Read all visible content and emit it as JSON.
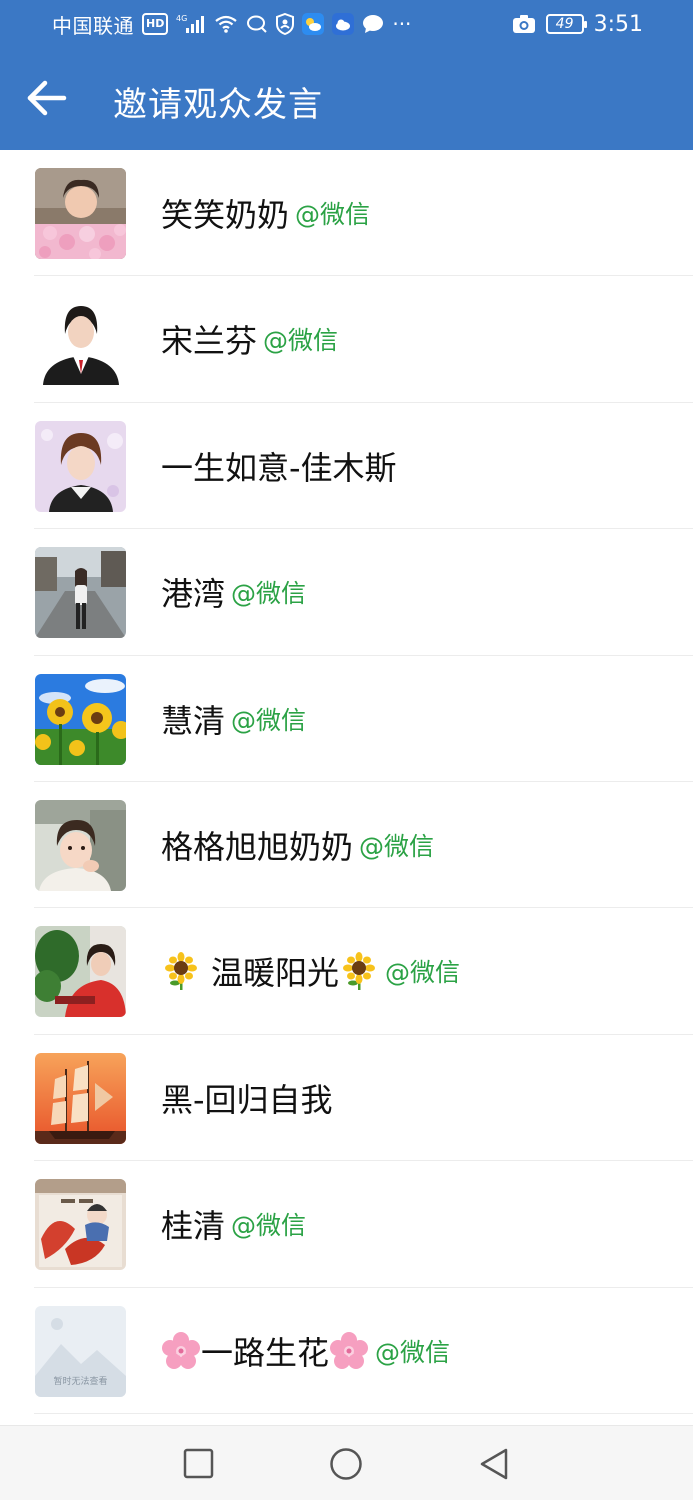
{
  "status_bar": {
    "carrier": "中国联通",
    "hd_badge": "HD",
    "network": "4G",
    "battery": "49",
    "time": "3:51",
    "overflow": "···"
  },
  "app_bar": {
    "title": "邀请观众发言",
    "back_icon": "arrow-left-icon"
  },
  "audience": [
    {
      "name": "笑笑奶奶",
      "tag": "@微信",
      "avatar": "woman-flowers"
    },
    {
      "name": "宋兰芬",
      "tag": "@微信",
      "avatar": "woman-suit"
    },
    {
      "name": "一生如意-佳木斯",
      "tag": "",
      "avatar": "woman-portrait"
    },
    {
      "name": "港湾",
      "tag": "@微信",
      "avatar": "street-walker"
    },
    {
      "name": "慧清",
      "tag": "@微信",
      "avatar": "sunflowers"
    },
    {
      "name": "格格旭旭奶奶",
      "tag": "@微信",
      "avatar": "child"
    },
    {
      "name_prefix_emoji": "sunflower",
      "name": "温暖阳光",
      "name_suffix_emoji": "sunflower",
      "tag": "@微信",
      "avatar": "woman-plants"
    },
    {
      "name": "黑-回归自我",
      "tag": "",
      "avatar": "sailing-ship"
    },
    {
      "name": "桂清",
      "tag": "@微信",
      "avatar": "painting"
    },
    {
      "name_prefix_emoji": "cherry-blossom",
      "name": "一路生花",
      "name_suffix_emoji": "cherry-blossom",
      "tag": "@微信",
      "avatar": "placeholder-image",
      "avatar_text": "暂时无法查看"
    }
  ],
  "nav_bar": {
    "items": [
      "recents-square-icon",
      "home-circle-icon",
      "back-triangle-icon"
    ]
  },
  "colors": {
    "header": "#3b78c5",
    "tag_green": "#2ba245"
  }
}
